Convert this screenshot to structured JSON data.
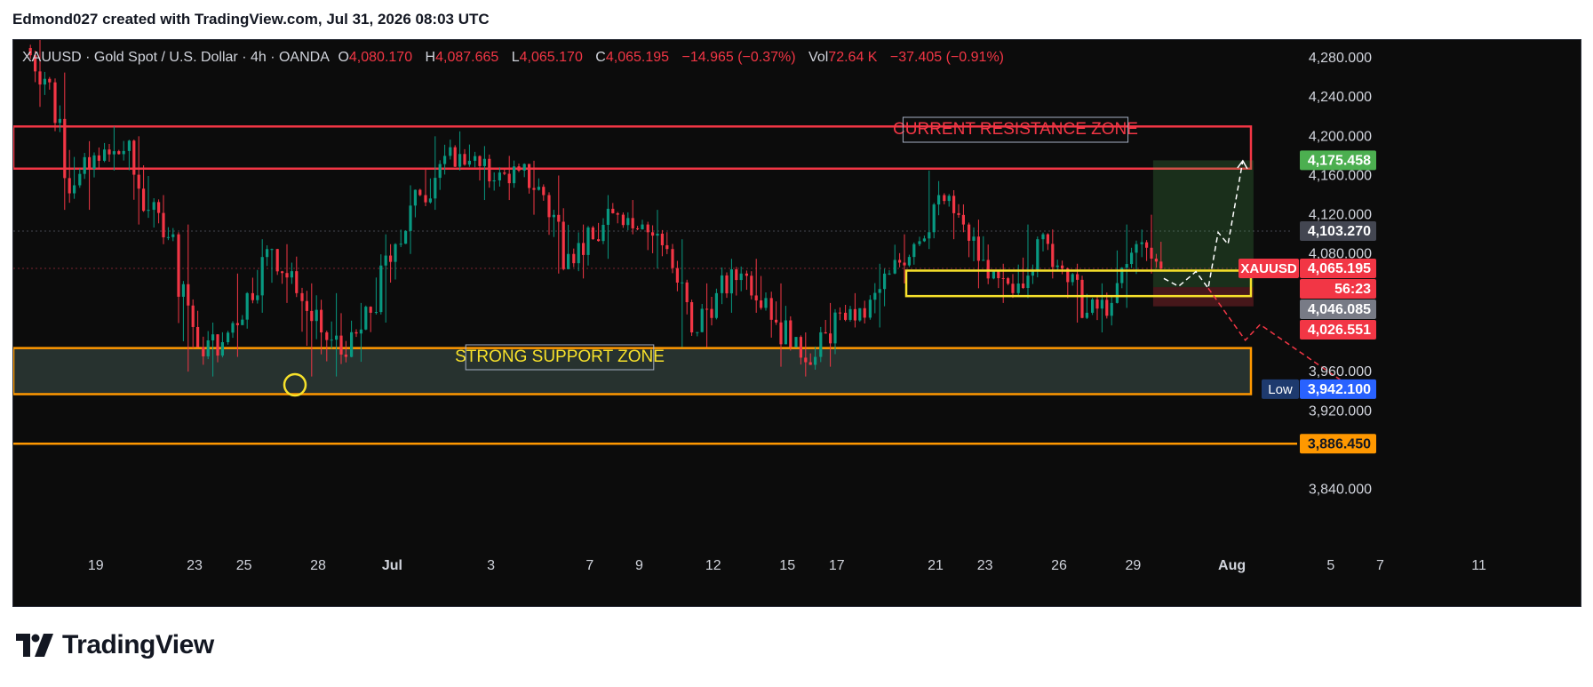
{
  "attribution": "Edmond027 created with TradingView.com, Jul 31, 2026 08:03 UTC",
  "footer_logo_text": "TradingView",
  "legend": {
    "symbol_title": "XAUUSD · Gold Spot / U.S. Dollar · 4h · OANDA",
    "o_label": "O",
    "o_value": "4,080.170",
    "h_label": "H",
    "h_value": "4,087.665",
    "l_label": "L",
    "l_value": "4,065.170",
    "c_label": "C",
    "c_value": "4,065.195",
    "change": "−14.965 (−0.37%)",
    "vol_label": "Vol",
    "vol_value": "72.64 K",
    "vol_change": "−37.405 (−0.91%)"
  },
  "colors": {
    "background": "#0c0c0c",
    "up": "#089981",
    "down": "#f23645",
    "resistance": "#f23645",
    "support": "#ff9800",
    "box": "#f7e12b",
    "target_green": "#4caf50",
    "text": "#d1d4dc"
  },
  "annotations": {
    "resistance_label": "CURRENT RESISTANCE ZONE",
    "support_label": "STRONG SUPPORT ZONE"
  },
  "price_badges": [
    {
      "text": "4,175.458",
      "bg": "#4caf50",
      "fg": "#ffffff"
    },
    {
      "text": "4,103.270",
      "bg": "#434651",
      "fg": "#ffffff"
    },
    {
      "text": "4,065.195",
      "bg": "#f23645",
      "fg": "#ffffff"
    },
    {
      "text": "56:23",
      "bg": "#f23645",
      "fg": "#ffffff"
    },
    {
      "text": "4,046.085",
      "bg": "#787b86",
      "fg": "#ffffff"
    },
    {
      "text": "4,026.551",
      "bg": "#f23645",
      "fg": "#ffffff"
    },
    {
      "text": "3,942.100",
      "bg": "#2962ff",
      "fg": "#ffffff"
    },
    {
      "text": "3,886.450",
      "bg": "#ff9800",
      "fg": "#131722"
    }
  ],
  "badge_tags": {
    "symbol": "XAUUSD",
    "low": "Low"
  },
  "chart_data": {
    "type": "candlestick",
    "symbol": "XAUUSD",
    "timeframe": "4h",
    "ylim": [
      3800,
      4300
    ],
    "y_ticks": [
      {
        "value": 4280,
        "label": "4,280.000"
      },
      {
        "value": 4240,
        "label": "4,240.000"
      },
      {
        "value": 4200,
        "label": "4,200.000"
      },
      {
        "value": 4160,
        "label": "4,160.000"
      },
      {
        "value": 4120,
        "label": "4,120.000"
      },
      {
        "value": 4080,
        "label": "4,080.000"
      },
      {
        "value": 3960,
        "label": "3,960.000"
      },
      {
        "value": 3920,
        "label": "3,920.000"
      },
      {
        "value": 3840,
        "label": "3,840.000"
      }
    ],
    "x_ticks": [
      {
        "day": 1,
        "label": "19"
      },
      {
        "day": 5,
        "label": "23"
      },
      {
        "day": 7,
        "label": "25"
      },
      {
        "day": 10,
        "label": "28"
      },
      {
        "day": 13,
        "label": "Jul"
      },
      {
        "day": 17,
        "label": "3"
      },
      {
        "day": 21,
        "label": "7"
      },
      {
        "day": 23,
        "label": "9"
      },
      {
        "day": 26,
        "label": "12"
      },
      {
        "day": 29,
        "label": "15"
      },
      {
        "day": 31,
        "label": "17"
      },
      {
        "day": 35,
        "label": "21"
      },
      {
        "day": 37,
        "label": "23"
      },
      {
        "day": 40,
        "label": "26"
      },
      {
        "day": 43,
        "label": "29"
      },
      {
        "day": 47,
        "label": "Aug"
      },
      {
        "day": 51,
        "label": "5"
      },
      {
        "day": 53,
        "label": "7"
      },
      {
        "day": 57,
        "label": "11"
      }
    ],
    "daily_ohlc": [
      {
        "day": 0,
        "o": 4290,
        "h": 4300,
        "l": 4230,
        "c": 4255
      },
      {
        "day": 1,
        "o": 4255,
        "h": 4265,
        "l": 4125,
        "c": 4150
      },
      {
        "day": 2,
        "o": 4150,
        "h": 4195,
        "l": 4125,
        "c": 4175
      },
      {
        "day": 3,
        "o": 4175,
        "h": 4210,
        "l": 4165,
        "c": 4185
      },
      {
        "day": 4,
        "o": 4185,
        "h": 4200,
        "l": 4110,
        "c": 4125
      },
      {
        "day": 5,
        "o": 4125,
        "h": 4140,
        "l": 4090,
        "c": 4100
      },
      {
        "day": 6,
        "o": 4100,
        "h": 4110,
        "l": 3960,
        "c": 3985
      },
      {
        "day": 7,
        "o": 3985,
        "h": 4010,
        "l": 3955,
        "c": 3990
      },
      {
        "day": 8,
        "o": 3990,
        "h": 4060,
        "l": 3975,
        "c": 4040
      },
      {
        "day": 9,
        "o": 4040,
        "h": 4095,
        "l": 4020,
        "c": 4085
      },
      {
        "day": 10,
        "o": 4085,
        "h": 4090,
        "l": 4030,
        "c": 4040
      },
      {
        "day": 11,
        "o": 4040,
        "h": 4050,
        "l": 3955,
        "c": 4000
      },
      {
        "day": 12,
        "o": 4000,
        "h": 4040,
        "l": 3955,
        "c": 3975
      },
      {
        "day": 13,
        "o": 3975,
        "h": 4030,
        "l": 3970,
        "c": 4020
      },
      {
        "day": 14,
        "o": 4020,
        "h": 4100,
        "l": 4010,
        "c": 4090
      },
      {
        "day": 15,
        "o": 4090,
        "h": 4150,
        "l": 4080,
        "c": 4140
      },
      {
        "day": 16,
        "o": 4140,
        "h": 4200,
        "l": 4125,
        "c": 4180
      },
      {
        "day": 17,
        "o": 4180,
        "h": 4205,
        "l": 4165,
        "c": 4175
      },
      {
        "day": 18,
        "o": 4175,
        "h": 4190,
        "l": 4135,
        "c": 4155
      },
      {
        "day": 19,
        "o": 4155,
        "h": 4180,
        "l": 4135,
        "c": 4165
      },
      {
        "day": 20,
        "o": 4165,
        "h": 4175,
        "l": 4120,
        "c": 4140
      },
      {
        "day": 21,
        "o": 4140,
        "h": 4160,
        "l": 4060,
        "c": 4080
      },
      {
        "day": 22,
        "o": 4080,
        "h": 4110,
        "l": 4055,
        "c": 4095
      },
      {
        "day": 23,
        "o": 4095,
        "h": 4140,
        "l": 4075,
        "c": 4120
      },
      {
        "day": 24,
        "o": 4120,
        "h": 4135,
        "l": 4100,
        "c": 4110
      },
      {
        "day": 25,
        "o": 4110,
        "h": 4125,
        "l": 4065,
        "c": 4085
      },
      {
        "day": 26,
        "o": 4085,
        "h": 4095,
        "l": 3985,
        "c": 4000
      },
      {
        "day": 27,
        "o": 4000,
        "h": 4050,
        "l": 3985,
        "c": 4040
      },
      {
        "day": 28,
        "o": 4040,
        "h": 4075,
        "l": 4020,
        "c": 4060
      },
      {
        "day": 29,
        "o": 4060,
        "h": 4075,
        "l": 4020,
        "c": 4035
      },
      {
        "day": 30,
        "o": 4035,
        "h": 4050,
        "l": 3965,
        "c": 3985
      },
      {
        "day": 31,
        "o": 3985,
        "h": 4000,
        "l": 3955,
        "c": 3975
      },
      {
        "day": 32,
        "o": 3975,
        "h": 4030,
        "l": 3965,
        "c": 4020
      },
      {
        "day": 33,
        "o": 4020,
        "h": 4040,
        "l": 4005,
        "c": 4015
      },
      {
        "day": 34,
        "o": 4015,
        "h": 4070,
        "l": 4005,
        "c": 4060
      },
      {
        "day": 35,
        "o": 4060,
        "h": 4100,
        "l": 4050,
        "c": 4090
      },
      {
        "day": 36,
        "o": 4090,
        "h": 4165,
        "l": 4085,
        "c": 4140
      },
      {
        "day": 37,
        "o": 4140,
        "h": 4145,
        "l": 4095,
        "c": 4110
      },
      {
        "day": 38,
        "o": 4110,
        "h": 4115,
        "l": 4045,
        "c": 4055
      },
      {
        "day": 39,
        "o": 4055,
        "h": 4070,
        "l": 4030,
        "c": 4040
      },
      {
        "day": 40,
        "o": 4040,
        "h": 4110,
        "l": 4035,
        "c": 4095
      },
      {
        "day": 41,
        "o": 4095,
        "h": 4105,
        "l": 4055,
        "c": 4065
      },
      {
        "day": 42,
        "o": 4065,
        "h": 4070,
        "l": 4010,
        "c": 4020
      },
      {
        "day": 43,
        "o": 4020,
        "h": 4050,
        "l": 4000,
        "c": 4030
      },
      {
        "day": 44,
        "o": 4030,
        "h": 4110,
        "l": 4025,
        "c": 4090
      },
      {
        "day": 45,
        "o": 4090,
        "h": 4120,
        "l": 4060,
        "c": 4065
      }
    ],
    "zones": [
      {
        "name": "current resistance zone",
        "low": 4167,
        "high": 4210
      },
      {
        "name": "strong support zone",
        "low": 3937,
        "high": 3984
      },
      {
        "name": "consolidation box",
        "low": 4037,
        "high": 4063
      }
    ],
    "horizontal_lines": [
      3886.45
    ],
    "scenario_up": [
      {
        "day": 45.5,
        "price": 4055
      },
      {
        "day": 46.1,
        "price": 4047
      },
      {
        "day": 46.8,
        "price": 4062
      },
      {
        "day": 47.3,
        "price": 4045
      },
      {
        "day": 47.7,
        "price": 4102
      },
      {
        "day": 48.1,
        "price": 4090
      },
      {
        "day": 48.7,
        "price": 4175
      }
    ],
    "scenario_down": [
      {
        "day": 47.3,
        "price": 4045
      },
      {
        "day": 48.8,
        "price": 3992
      },
      {
        "day": 49.4,
        "price": 4008
      },
      {
        "day": 53.2,
        "price": 3942
      }
    ]
  }
}
